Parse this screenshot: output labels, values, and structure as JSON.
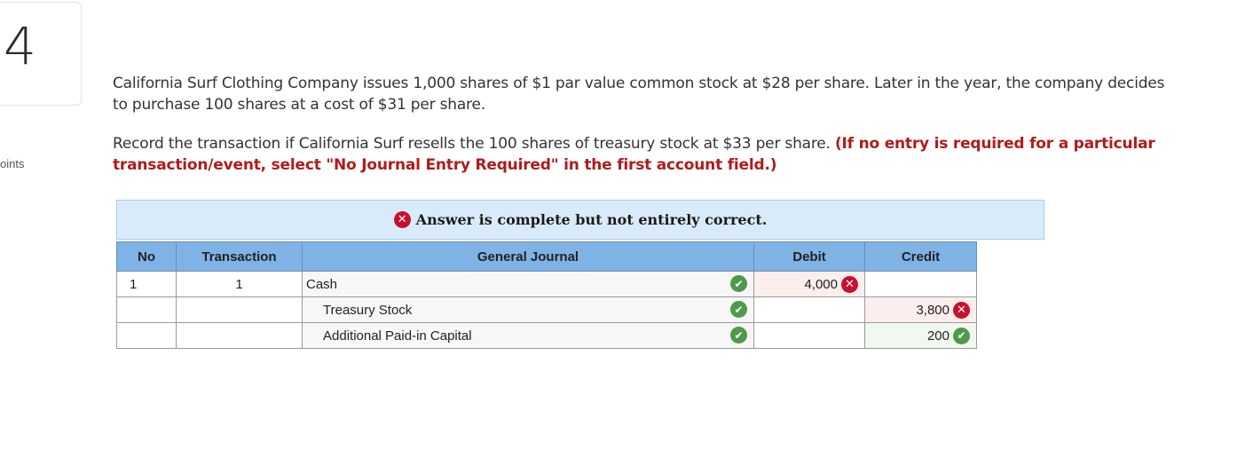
{
  "question": {
    "number": "4",
    "points_label": "oints",
    "text": "California Surf Clothing Company issues 1,000 shares of $1 par value common stock at $28 per share. Later in the year, the company decides to purchase 100 shares at a cost of $31 per share.",
    "instruction": "Record the transaction if California Surf resells the 100 shares of treasury stock at $33 per share.",
    "instruction_note": "(If no entry is required for a particular transaction/event, select \"No Journal Entry Required\" in the first account field.)"
  },
  "feedback": {
    "icon": "x-circle-icon",
    "text": "Answer is complete but not entirely correct."
  },
  "table": {
    "headers": {
      "no": "No",
      "transaction": "Transaction",
      "general_journal": "General Journal",
      "debit": "Debit",
      "credit": "Credit"
    },
    "rows": [
      {
        "no": "1",
        "transaction": "1",
        "account": "Cash",
        "debit": "4,000",
        "debit_status": "incorrect",
        "credit": "",
        "credit_status": ""
      },
      {
        "no": "",
        "transaction": "",
        "account": "Treasury Stock",
        "debit": "",
        "debit_status": "",
        "credit": "3,800",
        "credit_status": "incorrect"
      },
      {
        "no": "",
        "transaction": "",
        "account": "Additional Paid-in Capital",
        "debit": "",
        "debit_status": "",
        "credit": "200",
        "credit_status": "correct"
      }
    ]
  },
  "colors": {
    "header_blue": "#7fb3e6",
    "banner_blue": "#d9ebfa",
    "error_red": "#c8102e",
    "correct_green": "#4f9a4a",
    "note_red": "#b01b1b"
  }
}
